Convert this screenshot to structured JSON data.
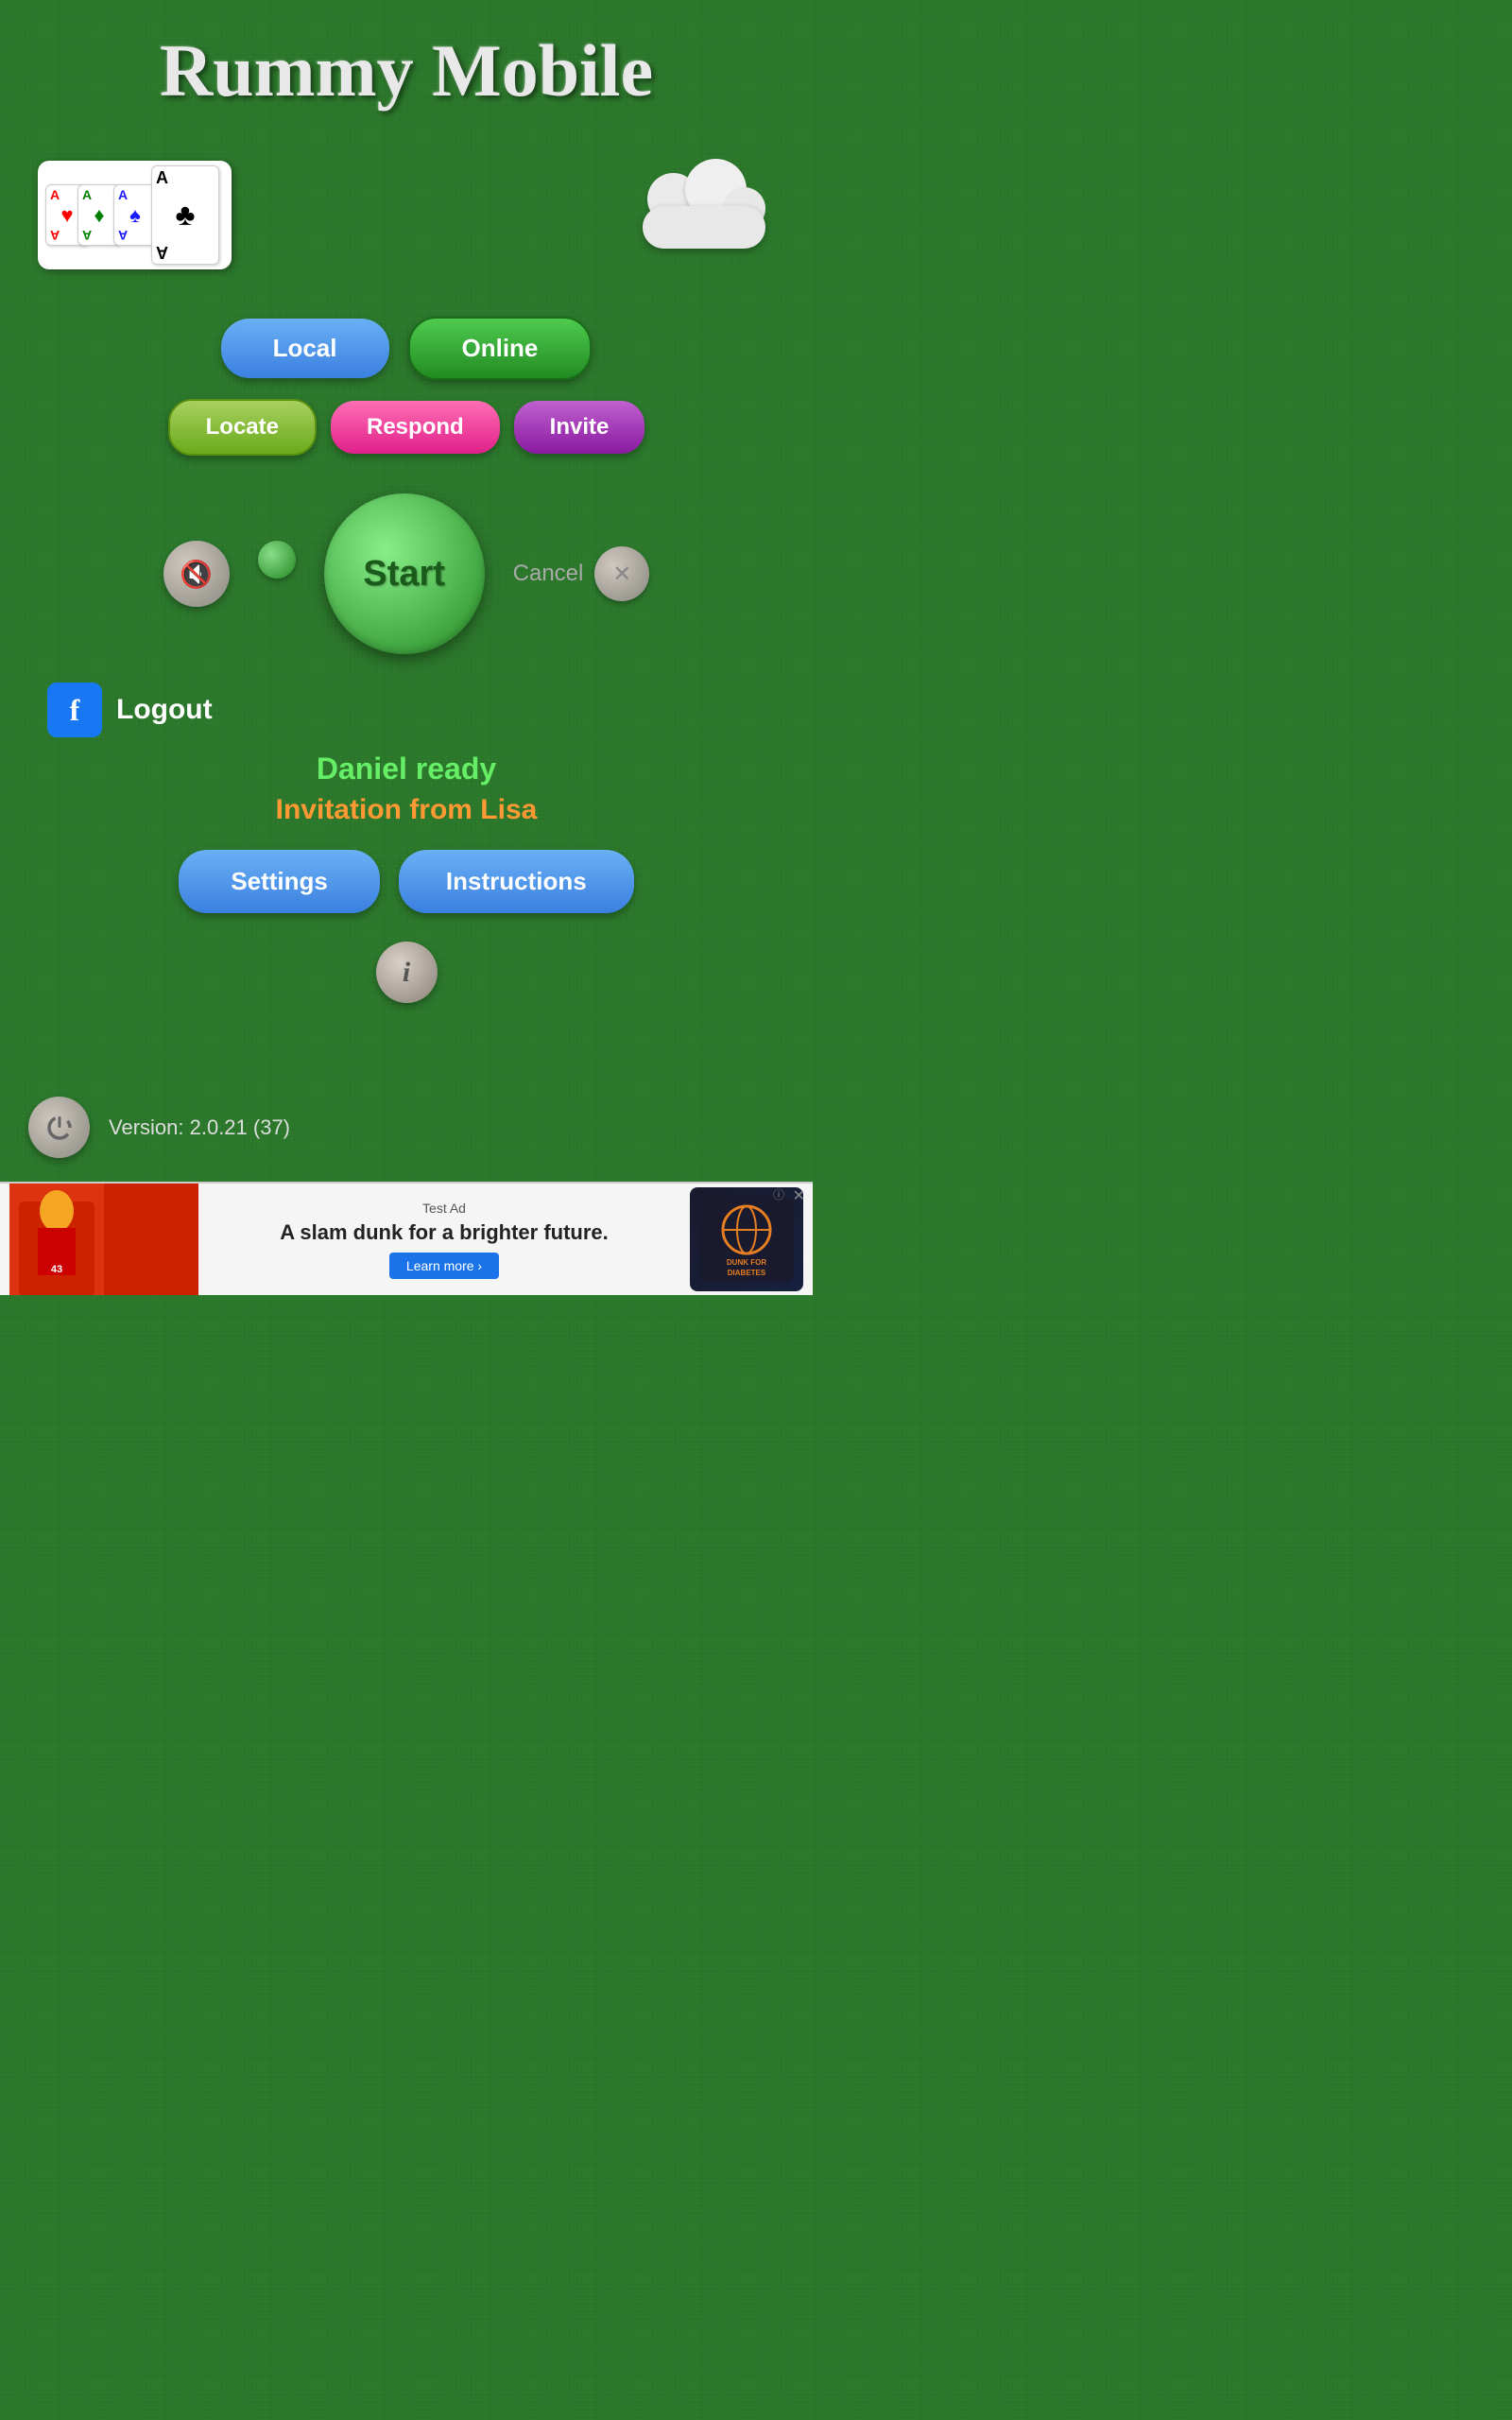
{
  "app": {
    "title": "Rummy Mobile"
  },
  "cards": [
    {
      "label": "A",
      "suit": "♥",
      "color": "red"
    },
    {
      "label": "A",
      "suit": "♦",
      "color": "green"
    },
    {
      "label": "A",
      "suit": "♠",
      "color": "blue"
    },
    {
      "label": "A",
      "suit": "♣",
      "color": "black"
    }
  ],
  "buttons": {
    "local": "Local",
    "online": "Online",
    "locate": "Locate",
    "respond": "Respond",
    "invite": "Invite",
    "start": "Start",
    "cancel": "Cancel",
    "logout": "Logout",
    "settings": "Settings",
    "instructions": "Instructions"
  },
  "status": {
    "player_ready": "Daniel ready",
    "invitation": "Invitation from Lisa"
  },
  "version": {
    "text": "Version: 2.0.21 (37)"
  },
  "ad": {
    "test_label": "Test Ad",
    "main_text": "A slam dunk for a brighter future.",
    "learn_more": "Learn more ›"
  }
}
